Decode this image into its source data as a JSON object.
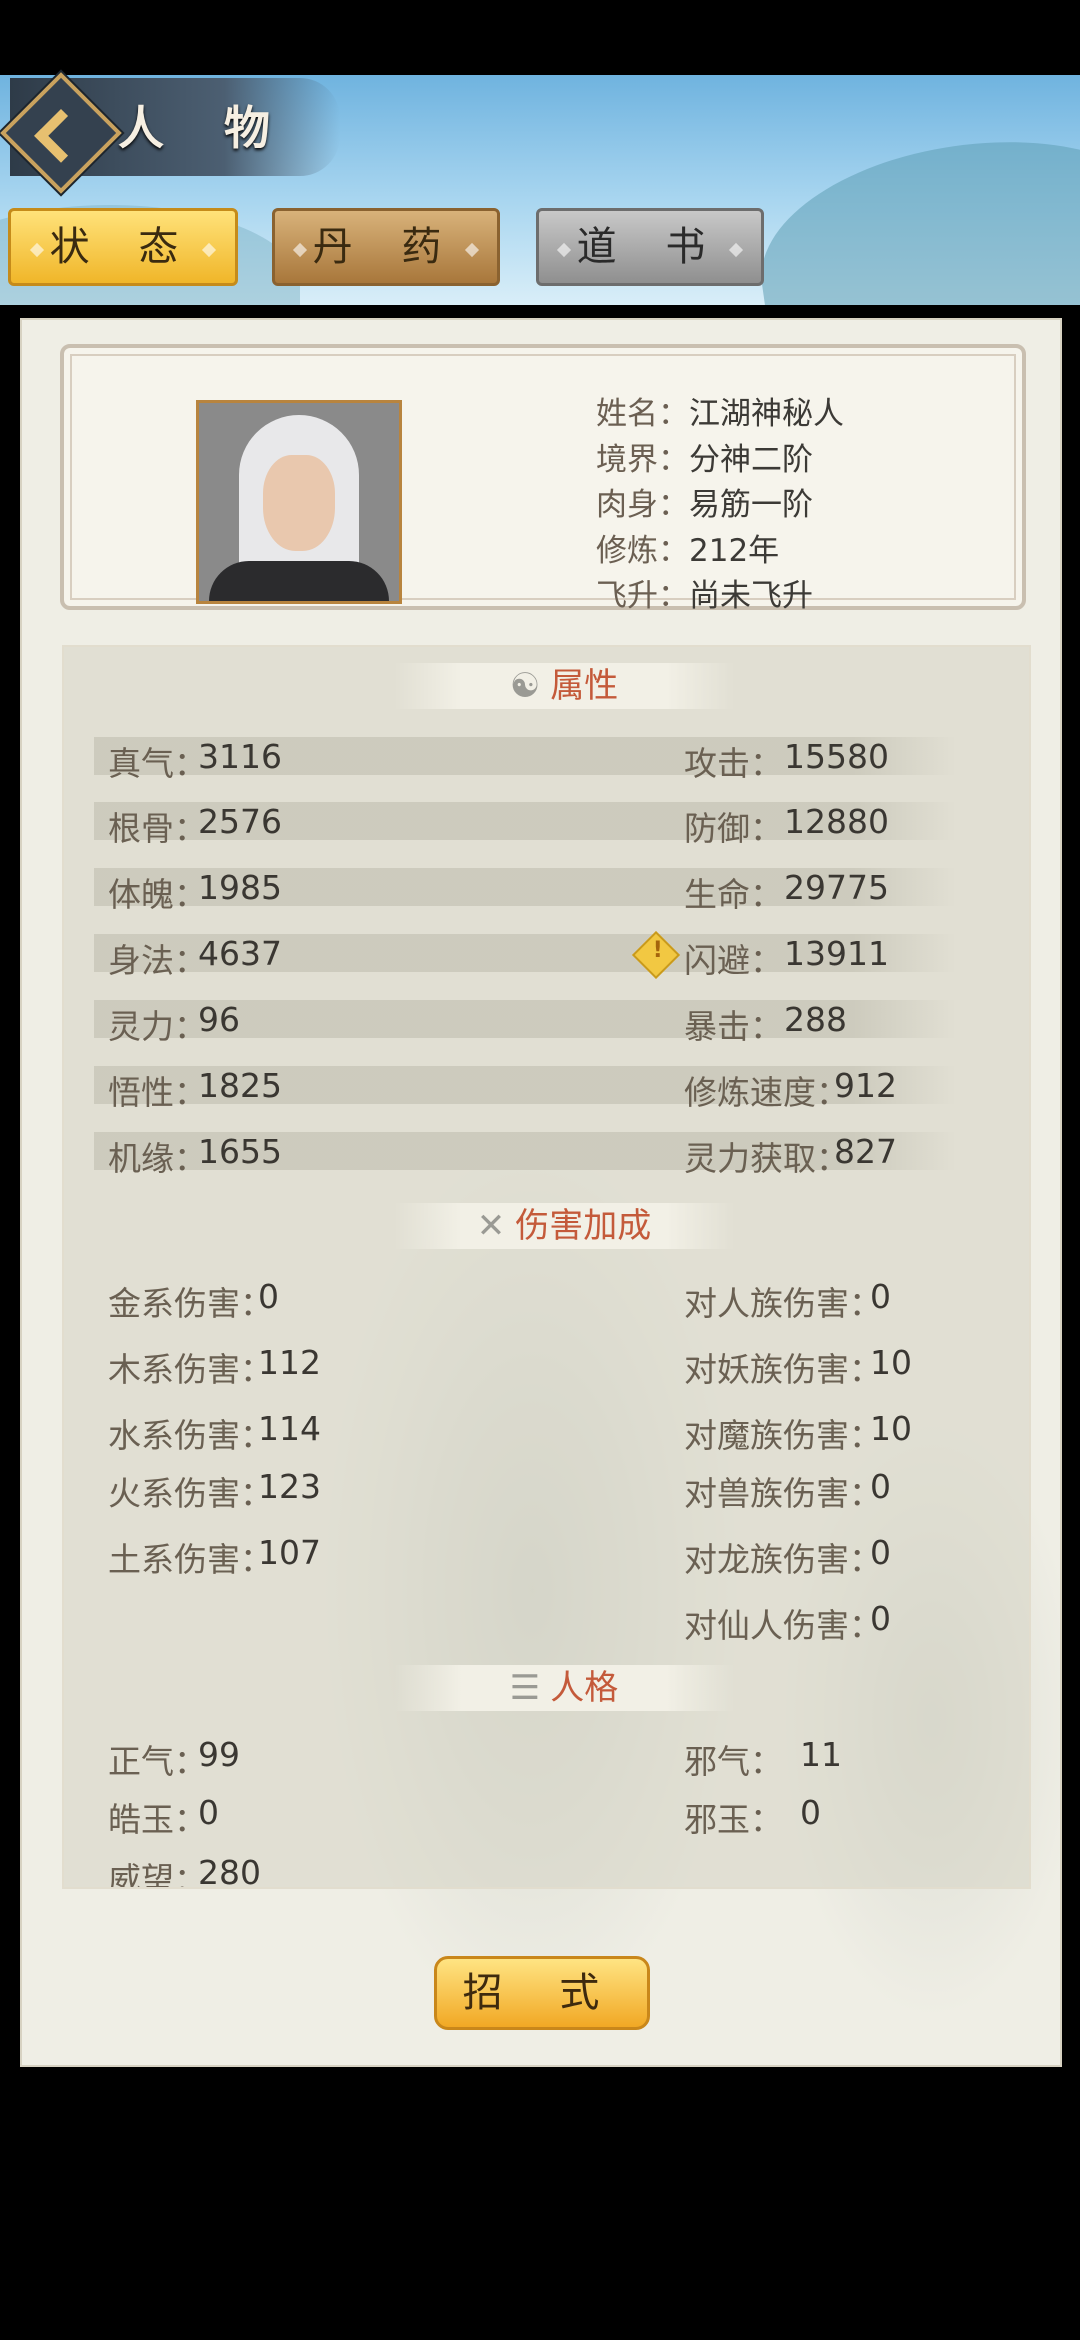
{
  "header": {
    "title": "人 物"
  },
  "tabs": [
    {
      "label": "状 态",
      "active": true
    },
    {
      "label": "丹 药",
      "active": false
    },
    {
      "label": "道 书",
      "active": false
    }
  ],
  "profile": {
    "name_key": "姓名：",
    "name": "江湖神秘人",
    "realm_key": "境界：",
    "realm": "分神二阶",
    "body_key": "肉身：",
    "body": "易筋一阶",
    "train_key": "修炼：",
    "train": "212年",
    "ascend_key": "飞升：",
    "ascend": "尚未飞升"
  },
  "sections": {
    "attributes": "属性",
    "damage": "伤害加成",
    "personality": "人格"
  },
  "attributes": [
    {
      "lk": "真气：",
      "lv": "3116",
      "rk": "攻击：",
      "rv": "15580"
    },
    {
      "lk": "根骨：",
      "lv": "2576",
      "rk": "防御：",
      "rv": "12880"
    },
    {
      "lk": "体魄：",
      "lv": "1985",
      "rk": "生命：",
      "rv": "29775"
    },
    {
      "lk": "身法：",
      "lv": "4637",
      "rk": "闪避：",
      "rv": "13911"
    },
    {
      "lk": "灵力：",
      "lv": "96",
      "rk": "暴击：",
      "rv": "288"
    },
    {
      "lk": "悟性：",
      "lv": "1825",
      "rk": "修炼速度：",
      "rv": "912"
    },
    {
      "lk": "机缘：",
      "lv": "1655",
      "rk": "灵力获取：",
      "rv": "827"
    }
  ],
  "damage": [
    {
      "lk": "金系伤害：",
      "lv": "0",
      "rk": "对人族伤害：",
      "rv": "0"
    },
    {
      "lk": "木系伤害：",
      "lv": "112",
      "rk": "对妖族伤害：",
      "rv": "10"
    },
    {
      "lk": "水系伤害：",
      "lv": "114",
      "rk": "对魔族伤害：",
      "rv": "10"
    },
    {
      "lk": "火系伤害：",
      "lv": "123",
      "rk": "对兽族伤害：",
      "rv": "0"
    },
    {
      "lk": "土系伤害：",
      "lv": "107",
      "rk": "对龙族伤害：",
      "rv": "0"
    },
    {
      "lk": "",
      "lv": "",
      "rk": "对仙人伤害：",
      "rv": "0"
    }
  ],
  "personality": [
    {
      "lk": "正气：",
      "lv": "99",
      "rk": "邪气：",
      "rv": "11"
    },
    {
      "lk": "皓玉：",
      "lv": "0",
      "rk": "邪玉：",
      "rv": "0"
    },
    {
      "lk": "威望：",
      "lv": "280",
      "rk": "",
      "rv": ""
    }
  ],
  "skill_button": "招 式",
  "warning_glyph": "!"
}
